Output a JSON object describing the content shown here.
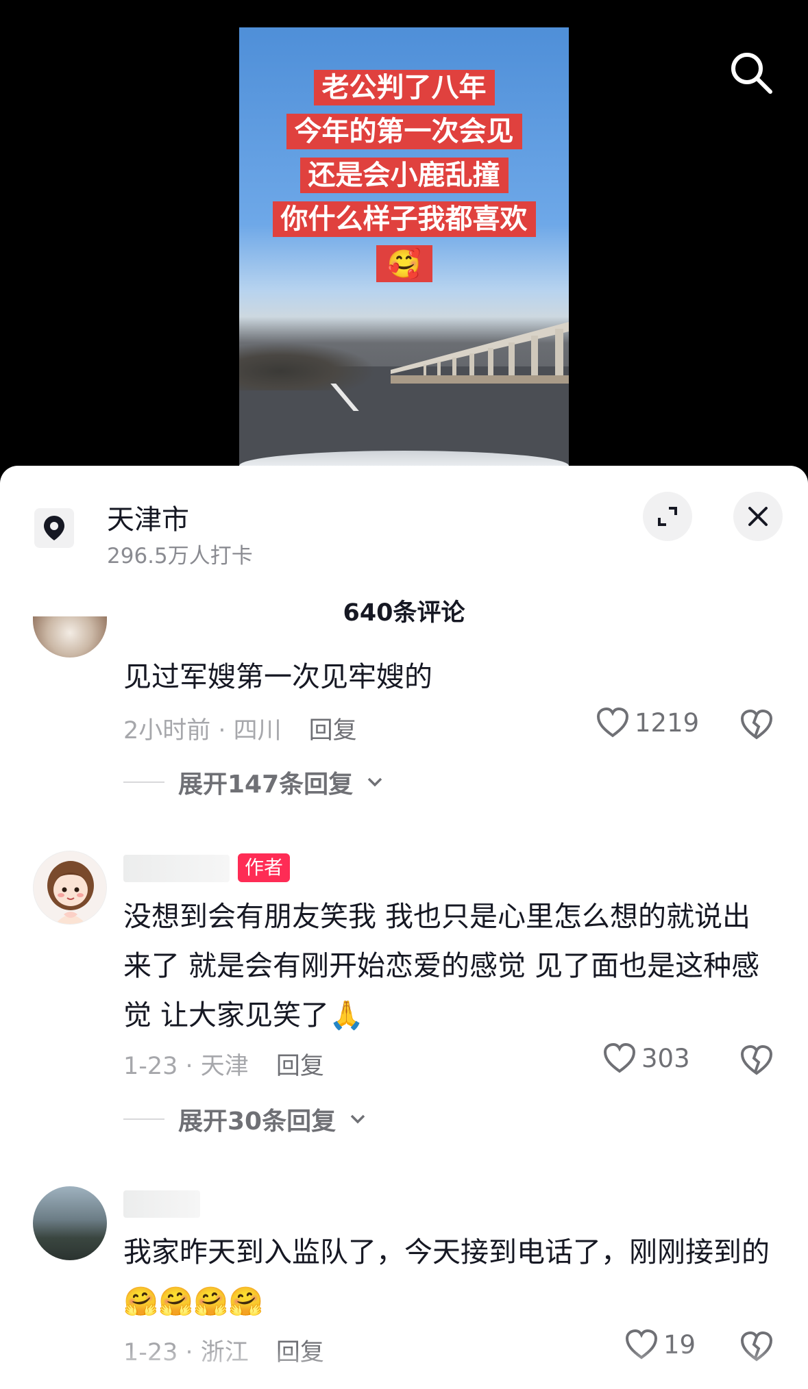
{
  "video": {
    "caption_lines": [
      "老公判了八年",
      "今年的第一次会见",
      "还是会小鹿乱撞",
      "你什么样子我都喜欢"
    ],
    "caption_emoji": "🥰",
    "search_icon": "search-icon"
  },
  "location": {
    "title": "天津市",
    "subtitle": "296.5万人打卡"
  },
  "comments_header": {
    "count_label": "640条评论"
  },
  "comments": [
    {
      "text": "见过军嫂第一次见牢嫂的",
      "meta": "2小时前 · 四川",
      "reply": "回复",
      "likes": "1219",
      "expand": "展开147条回复"
    },
    {
      "tag": "作者",
      "text": "没想到会有朋友笑我 我也只是心里怎么想的就说出来了 就是会有刚开始恋爱的感觉 见了面也是这种感觉 让大家见笑了🙏",
      "meta": "1-23 · 天津",
      "reply": "回复",
      "likes": "303",
      "expand": "展开30条回复"
    },
    {
      "text": "我家昨天到入监队了，今天接到电话了，刚刚接到的🤗🤗🤗🤗",
      "meta": "1-23 · 浙江",
      "reply": "回复",
      "likes": "19"
    }
  ],
  "colors": {
    "accent": "#fe2c55",
    "caption_bg": "#e0413e"
  }
}
